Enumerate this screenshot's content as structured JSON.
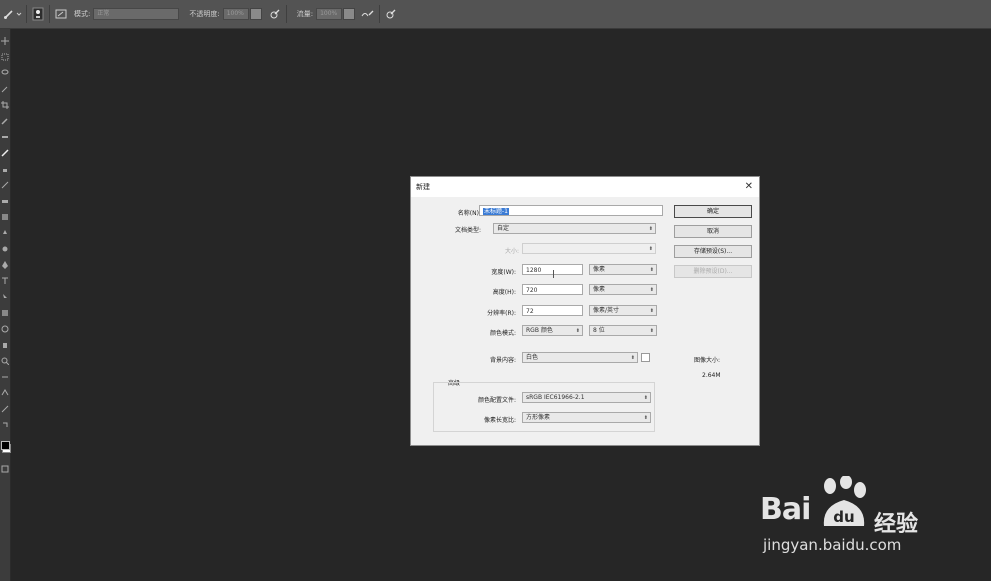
{
  "options_bar": {
    "mode_label": "模式:",
    "mode_value": "正常",
    "opacity_label": "不透明度:",
    "opacity_value": "100%",
    "flow_label": "流量:",
    "flow_value": "100%"
  },
  "dialog": {
    "title": "新建",
    "name_label": "名称(N):",
    "name_value": "未标题-1",
    "preset_label": "文档类型:",
    "preset_value": "自定",
    "size_label": "大小:",
    "width_label": "宽度(W):",
    "width_value": "1280",
    "width_unit": "像素",
    "height_label": "高度(H):",
    "height_value": "720",
    "height_unit": "像素",
    "resolution_label": "分辨率(R):",
    "resolution_value": "72",
    "resolution_unit": "像素/英寸",
    "color_mode_label": "颜色模式:",
    "color_mode_value": "RGB 颜色",
    "bit_depth_value": "8 位",
    "background_label": "背景内容:",
    "background_value": "白色",
    "advanced_label": "高级",
    "color_profile_label": "颜色配置文件:",
    "color_profile_value": "sRGB IEC61966-2.1",
    "pixel_aspect_label": "像素长宽比:",
    "pixel_aspect_value": "方形像素",
    "ok_button": "确定",
    "cancel_button": "取消",
    "save_preset_button": "存储预设(S)...",
    "delete_preset_button": "删除预设(D)...",
    "image_size_label": "图像大小:",
    "image_size_value": "2.64M"
  },
  "watermark": {
    "brand_left": "Bai",
    "brand_du": "du",
    "brand_cn": "经验",
    "url": "jingyan.baidu.com"
  }
}
